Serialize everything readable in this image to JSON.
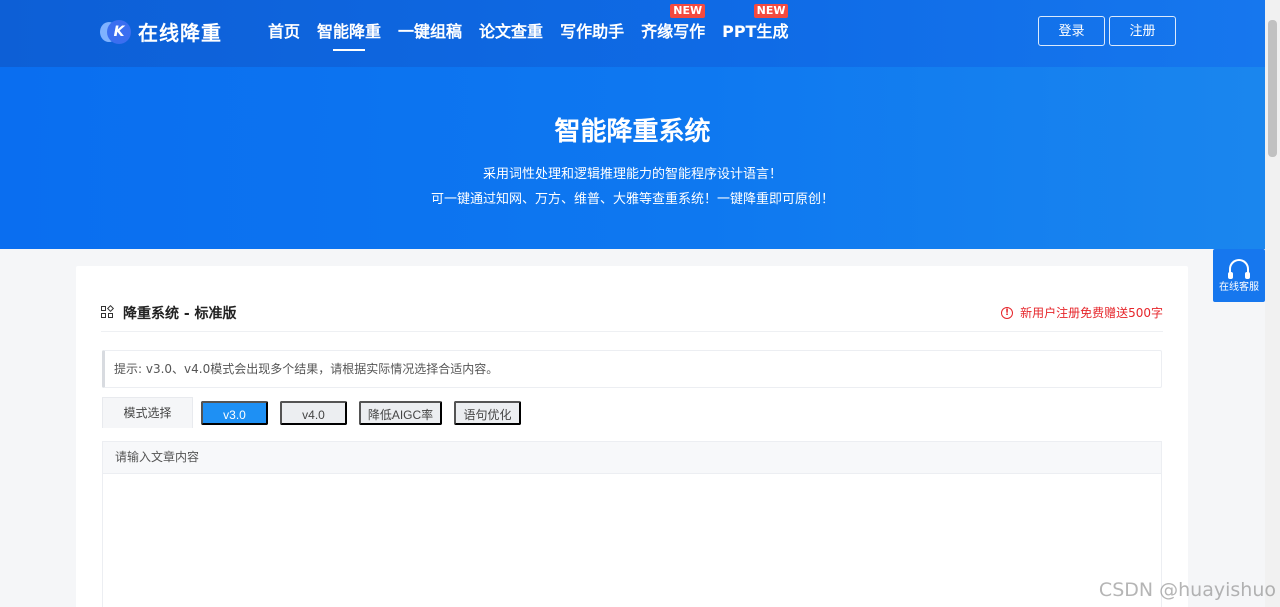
{
  "brand": {
    "logo_letter": "K",
    "name": "在线降重"
  },
  "nav": [
    {
      "label": "首页",
      "active": false,
      "badge": ""
    },
    {
      "label": "智能降重",
      "active": true,
      "badge": ""
    },
    {
      "label": "一键组稿",
      "active": false,
      "badge": ""
    },
    {
      "label": "论文查重",
      "active": false,
      "badge": ""
    },
    {
      "label": "写作助手",
      "active": false,
      "badge": ""
    },
    {
      "label": "齐缘写作",
      "active": false,
      "badge": "NEW"
    },
    {
      "label": "PPT生成",
      "active": false,
      "badge": "NEW"
    }
  ],
  "auth": {
    "login": "登录",
    "register": "注册"
  },
  "hero": {
    "title": "智能降重系统",
    "line1": "采用词性处理和逻辑推理能力的智能程序设计语言！",
    "line2": "可一键通过知网、万方、维普、大雅等查重系统！一键降重即可原创！"
  },
  "card": {
    "title": "降重系统 - 标准版",
    "promo": "新用户注册免费赠送500字",
    "tip": "提示: v3.0、v4.0模式会出现多个结果，请根据实际情况选择合适内容。",
    "mode_label": "模式选择",
    "modes": [
      {
        "label": "v3.0",
        "active": true
      },
      {
        "label": "v4.0",
        "active": false
      },
      {
        "label": "降低AIGC率",
        "active": false
      },
      {
        "label": "语句优化",
        "active": false
      }
    ],
    "editor_placeholder": "请输入文章内容"
  },
  "service": {
    "label": "在线客服"
  },
  "watermark": "CSDN @huayishuo",
  "colors": {
    "header": "#0f6be6",
    "hero": "#0e78f0",
    "accent": "#1e90f4",
    "badge": "#f44a3f",
    "promo": "#e6262b"
  }
}
